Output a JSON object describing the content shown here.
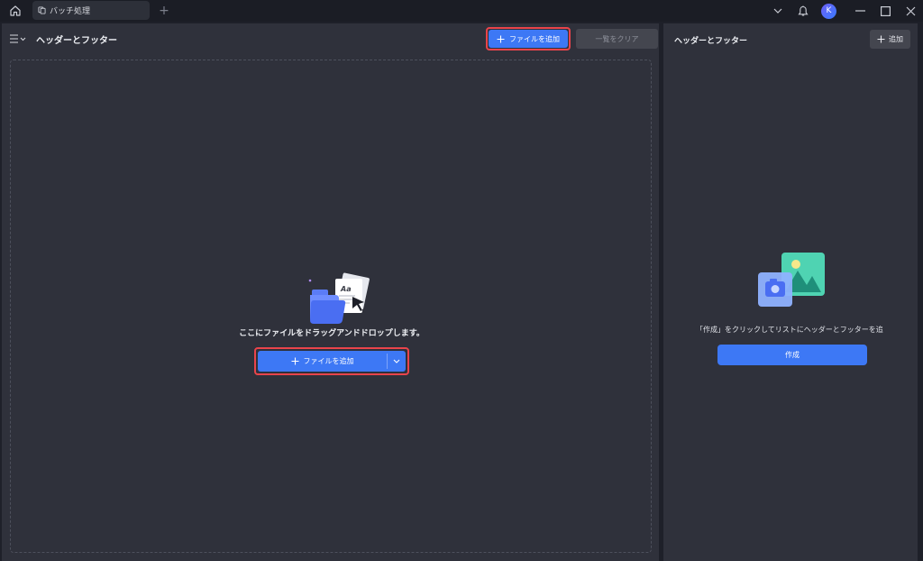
{
  "titlebar": {
    "tab_label": "バッチ処理",
    "tab_add_symbol": "+",
    "avatar_initial": "K"
  },
  "left_panel": {
    "title": "ヘッダーとフッター",
    "add_file_button": "ファイルを追加",
    "clear_list_button": "一覧をクリア",
    "drop_text": "ここにファイルをドラッグアンドドロップします。",
    "center_add_file_button": "ファイルを追加",
    "illustration_text": "Aa"
  },
  "right_panel": {
    "title": "ヘッダーとフッター",
    "add_button": "追加",
    "hint": "「作成」をクリックしてリストにヘッダーとフッターを追",
    "create_button": "作成"
  },
  "colors": {
    "accent": "#3d78f5",
    "highlight_border": "#e9444b",
    "panel_bg": "#2f313b",
    "app_bg": "#1e2029"
  },
  "icons": [
    "home-icon",
    "batch-icon",
    "chevron-down-icon",
    "bell-icon",
    "minimize-icon",
    "maximize-icon",
    "close-icon",
    "menu-icon",
    "plus-icon"
  ]
}
